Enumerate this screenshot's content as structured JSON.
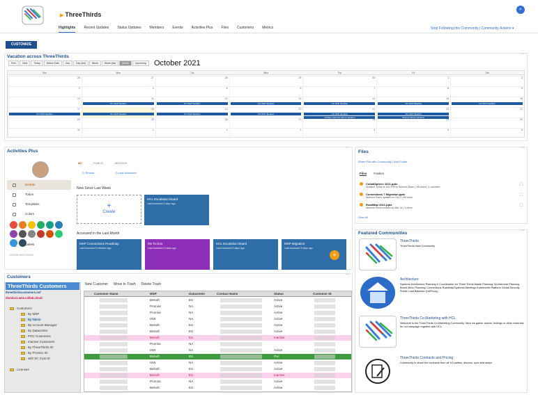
{
  "header": {
    "brand": "ThreeThirds",
    "nav": [
      "Highlights",
      "Recent Updates",
      "Status Updates",
      "Members",
      "Events",
      "Activities Plus",
      "Files",
      "Customers",
      "Metrics"
    ],
    "nav_right": "Stop Following this Community  |  Community Actions ▾",
    "customize": "CUSTOMIZE"
  },
  "calendar": {
    "title": "Vacation across ThreeThirds",
    "toolbar": [
      "Prev",
      "Next",
      "Today",
      "Select Date",
      "Day",
      "Day (list)",
      "Week",
      "Week (list)",
      "Month",
      "Upcoming"
    ],
    "month": "October 2021",
    "days": [
      "Sun",
      "Mon",
      "Tue",
      "Wed",
      "Thu",
      "Fri",
      "Sat"
    ],
    "weeks": [
      [
        "26",
        "27",
        "28",
        "29",
        "30",
        "1",
        "2"
      ],
      [
        "3",
        "4",
        "5",
        "6",
        "7",
        "8",
        "9"
      ],
      [
        "10",
        "11",
        "12",
        "13",
        "14",
        "15",
        "16"
      ],
      [
        "17",
        "18",
        "19",
        "20",
        "21",
        "22",
        "23"
      ],
      [
        "24",
        "25",
        "26",
        "27",
        "28",
        "29",
        "30"
      ],
      [
        "31",
        "1",
        "2",
        "3",
        "4",
        "5",
        "6"
      ]
    ],
    "event_label": "Urs Wolf Vacation",
    "event_label2": "10:00pm Wannes Rams Vacation",
    "event_label3": "Wannes Rams Vacation"
  },
  "activities": {
    "title": "Activities Plus",
    "menu": [
      "Boards",
      "Todos",
      "Templates",
      "Colors",
      "Labels"
    ],
    "archived": "SHOW ARCHIVED",
    "tabs": [
      "MY",
      "PUBLIC",
      "ARCHIVE"
    ],
    "icon_labels": [
      "Recent",
      "Last Accessed"
    ],
    "section1": "New Since Last Week",
    "create": "Create",
    "card1_title": "HCL Escalation Board",
    "card1_sub": "Last Accessed 3 days ago",
    "section2": "Accessed in the Last Month",
    "cards": [
      {
        "title": "MSP Connections Roadmap",
        "sub": "Last Accessed 3 minutes ago",
        "color": "#2e6da8"
      },
      {
        "title": "Ms To Dos",
        "sub": "Last Accessed 3 days ago",
        "color": "#8e2fb8"
      },
      {
        "title": "HCL Escalation Board",
        "sub": "Last Accessed 3 days ago",
        "color": "#2e6da8"
      },
      {
        "title": "MSP Migration",
        "sub": "Last Accessed 3 days ago",
        "color": "#2e6da8"
      }
    ],
    "fab": "+"
  },
  "files": {
    "title": "Files",
    "share": "Share File with Community  |  Add Folder",
    "tabs": [
      "Files",
      "Folders"
    ],
    "items": [
      {
        "name": "CollabSphere 2021.pptx",
        "sub": "Updated Today at 3:51 PM by Wannes Rams | 98 views | 1 comment"
      },
      {
        "name": "Connections 7 Migration.pptx",
        "sub": "Wannes Rams updated on Oct 2 | 98 views"
      },
      {
        "name": "RoadMap 2021.pptx",
        "sub": "Wannes Rams created on Mar 14 | 3 views"
      }
    ],
    "view_all": "View All"
  },
  "communities": {
    "title": "Featured Communities",
    "items": [
      {
        "title": "ThreeThirds",
        "desc": "ThreeThirds Main Community"
      },
      {
        "title": "Architecture",
        "desc": "Systems Architecture Planning & Coordination for Three Thirds  Waste Planning: Architecture Planning Board  Micro Planning: Connections Roadmap/Systems Meetings Kubernetes Platform Global Security Public Load Balancer (HAProxy)"
      },
      {
        "title": "ThreeThirds Co-Marketing with HCL",
        "desc": "Welcome to the ThreeThirds Co-Marketing Community. Here we gather assets, findings or other materials for our campaign together with HCL."
      },
      {
        "title": "ThreeThirds Contracts and Pricing",
        "desc": "Community to share the contracts from all 3/3 parties, discuss, sync and adapt"
      }
    ]
  },
  "customers": {
    "title": "Customers",
    "tree_title": "ThreeThirds Customers",
    "tree_sub1": "threethirdscustomers.nsf",
    "tree_sub2": "domino1.ams.collab.cloud",
    "tree": [
      "Customers",
      "By MSP",
      "By Name",
      "By Account Manager",
      "By Datacenter",
      "POC Customers",
      "Inactive Customers",
      "By ThreeThirds ID",
      "By Promisc ID",
      "with SC Cust ID",
      "Licenses"
    ],
    "toolbar": [
      "New Customer",
      "Move to Trash",
      "Delete Trash"
    ],
    "columns": [
      "Customer Name",
      "MSP",
      "Datacenter",
      "Contact Name",
      "Status",
      "Customer ID"
    ],
    "rows": [
      [
        "Belsoft",
        "EU",
        "Active"
      ],
      [
        "Promisc",
        "NA",
        "Active"
      ],
      [
        "Promisc",
        "NA",
        "Active"
      ],
      [
        "ISW",
        "NA",
        "Active"
      ],
      [
        "Belsoft",
        "EU",
        "Active"
      ],
      [
        "Belsoft",
        "EU",
        "Active"
      ],
      [
        "Belsoft",
        "EU",
        "Inactive"
      ],
      [
        "Promisc",
        "NA",
        ""
      ],
      [
        "ISW",
        "NA",
        "Active"
      ],
      [
        "Belsoft",
        "EU",
        "Poc"
      ],
      [
        "ISW",
        "NA",
        "Active"
      ],
      [
        "Belsoft",
        "EU",
        "Active"
      ],
      [
        "Belsoft",
        "EU",
        "Inactive"
      ],
      [
        "Promisc",
        "NA",
        "Active"
      ],
      [
        "Belsoft",
        "EU",
        "Active"
      ]
    ]
  }
}
